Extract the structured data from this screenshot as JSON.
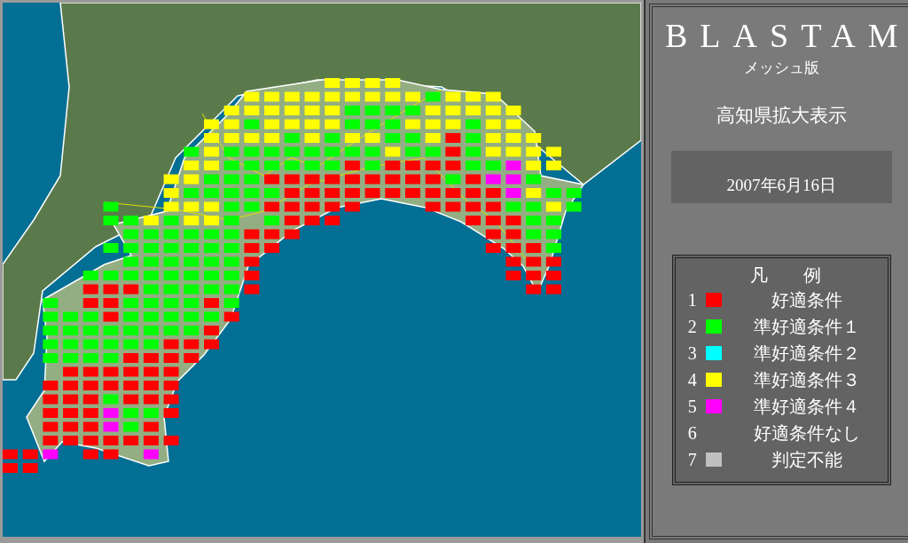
{
  "panel": {
    "title": "BLASTAM",
    "subtitle": "メッシュ版",
    "region": "高知県拡大表示",
    "date": "2007年6月16日"
  },
  "legend": {
    "title": "凡　　例",
    "items": [
      {
        "number": "1",
        "label": "好適条件",
        "color": "#ff0000"
      },
      {
        "number": "2",
        "label": "準好適条件１",
        "color": "#00ff00"
      },
      {
        "number": "3",
        "label": "準好適条件２",
        "color": "#00ffff"
      },
      {
        "number": "4",
        "label": "準好適条件３",
        "color": "#ffff00"
      },
      {
        "number": "5",
        "label": "準好適条件４",
        "color": "#ff00ff"
      },
      {
        "number": "6",
        "label": "好適条件なし"
      },
      {
        "number": "7",
        "label": "判定不能",
        "color": "#c0c0c0"
      }
    ]
  }
}
